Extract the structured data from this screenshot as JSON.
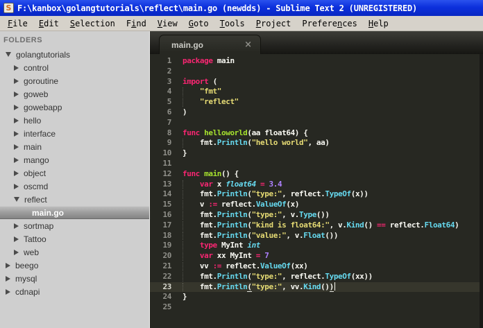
{
  "window": {
    "title": "F:\\kanbox\\golangtutorials\\reflect\\main.go (newdds) - Sublime Text 2 (UNREGISTERED)",
    "app_icon_letter": "S"
  },
  "menu": {
    "items": [
      {
        "label": "File",
        "u": 0
      },
      {
        "label": "Edit",
        "u": 0
      },
      {
        "label": "Selection",
        "u": 0
      },
      {
        "label": "Find",
        "u": 1
      },
      {
        "label": "View",
        "u": 0
      },
      {
        "label": "Goto",
        "u": 0
      },
      {
        "label": "Tools",
        "u": 0
      },
      {
        "label": "Project",
        "u": 0
      },
      {
        "label": "Preferences",
        "u": 7
      },
      {
        "label": "Help",
        "u": 0
      }
    ]
  },
  "sidebar": {
    "header": "FOLDERS",
    "items": [
      {
        "label": "golangtutorials",
        "level": 0,
        "kind": "open"
      },
      {
        "label": "control",
        "level": 1,
        "kind": "closed"
      },
      {
        "label": "goroutine",
        "level": 1,
        "kind": "closed"
      },
      {
        "label": "goweb",
        "level": 1,
        "kind": "closed"
      },
      {
        "label": "gowebapp",
        "level": 1,
        "kind": "closed"
      },
      {
        "label": "hello",
        "level": 1,
        "kind": "closed"
      },
      {
        "label": "interface",
        "level": 1,
        "kind": "closed"
      },
      {
        "label": "main",
        "level": 1,
        "kind": "closed"
      },
      {
        "label": "mango",
        "level": 1,
        "kind": "closed"
      },
      {
        "label": "object",
        "level": 1,
        "kind": "closed"
      },
      {
        "label": "oscmd",
        "level": 1,
        "kind": "closed"
      },
      {
        "label": "reflect",
        "level": 1,
        "kind": "open"
      },
      {
        "label": "main.go",
        "level": 2,
        "kind": "file",
        "selected": true
      },
      {
        "label": "sortmap",
        "level": 1,
        "kind": "closed"
      },
      {
        "label": "Tattoo",
        "level": 1,
        "kind": "closed"
      },
      {
        "label": "web",
        "level": 1,
        "kind": "closed"
      },
      {
        "label": "beego",
        "level": 0,
        "kind": "closed"
      },
      {
        "label": "mysql",
        "level": 0,
        "kind": "closed"
      },
      {
        "label": "cdnapi",
        "level": 0,
        "kind": "closed"
      }
    ]
  },
  "tab": {
    "label": "main.go",
    "close_glyph": "×"
  },
  "theme": {
    "titlebar_blue": "#0c30dc",
    "menubar_bg": "#d6d2ca",
    "sidebar_bg": "#cfcfcf",
    "editor_bg": "#272822",
    "current_line_bg": "#36362c",
    "line_number": "#90908a",
    "keyword_pink": "#f92672",
    "string_yellow": "#e6db74",
    "call_cyan": "#66d9ef",
    "number_purple": "#ae81ff",
    "type_italic_cyan": "#66d9ef",
    "func_def_green": "#a6e22e",
    "plain_text": "#f8f8f2"
  },
  "editor": {
    "lines": [
      {
        "n": 1,
        "seg": [
          [
            "package",
            "kw"
          ],
          [
            " main",
            "pl"
          ]
        ]
      },
      {
        "n": 2,
        "seg": []
      },
      {
        "n": 3,
        "seg": [
          [
            "import",
            "kw"
          ],
          [
            " (",
            "pl"
          ]
        ]
      },
      {
        "n": 4,
        "g": 1,
        "seg": [
          [
            "    ",
            "pl"
          ],
          [
            "\"fmt\"",
            "str"
          ]
        ]
      },
      {
        "n": 5,
        "g": 1,
        "seg": [
          [
            "    ",
            "pl"
          ],
          [
            "\"reflect\"",
            "str"
          ]
        ]
      },
      {
        "n": 6,
        "seg": [
          [
            ")",
            "pl"
          ]
        ]
      },
      {
        "n": 7,
        "seg": []
      },
      {
        "n": 8,
        "seg": [
          [
            "func",
            "kw"
          ],
          [
            " ",
            "pl"
          ],
          [
            "helloworld",
            "fn"
          ],
          [
            "(aa float64) {",
            "pl"
          ]
        ]
      },
      {
        "n": 9,
        "g": 1,
        "seg": [
          [
            "    fmt.",
            "pl"
          ],
          [
            "Println",
            "call"
          ],
          [
            "(",
            "pl"
          ],
          [
            "\"hello world\"",
            "str"
          ],
          [
            ", aa)",
            "pl"
          ]
        ]
      },
      {
        "n": 10,
        "seg": [
          [
            "}",
            "pl"
          ]
        ]
      },
      {
        "n": 11,
        "seg": []
      },
      {
        "n": 12,
        "seg": [
          [
            "func",
            "kw"
          ],
          [
            " ",
            "pl"
          ],
          [
            "main",
            "fn"
          ],
          [
            "() {",
            "pl"
          ]
        ]
      },
      {
        "n": 13,
        "g": 1,
        "seg": [
          [
            "    ",
            "pl"
          ],
          [
            "var",
            "kw"
          ],
          [
            " x ",
            "pl"
          ],
          [
            "float64",
            "typ"
          ],
          [
            " ",
            "pl"
          ],
          [
            "=",
            "kw"
          ],
          [
            " ",
            "pl"
          ],
          [
            "3.4",
            "num"
          ]
        ]
      },
      {
        "n": 14,
        "g": 1,
        "seg": [
          [
            "    fmt.",
            "pl"
          ],
          [
            "Println",
            "call"
          ],
          [
            "(",
            "pl"
          ],
          [
            "\"type:\"",
            "str"
          ],
          [
            ", reflect.",
            "pl"
          ],
          [
            "TypeOf",
            "call"
          ],
          [
            "(x))",
            "pl"
          ]
        ]
      },
      {
        "n": 15,
        "g": 1,
        "seg": [
          [
            "    v ",
            "pl"
          ],
          [
            ":=",
            "kw"
          ],
          [
            " reflect.",
            "pl"
          ],
          [
            "ValueOf",
            "call"
          ],
          [
            "(x)",
            "pl"
          ]
        ]
      },
      {
        "n": 16,
        "g": 1,
        "seg": [
          [
            "    fmt.",
            "pl"
          ],
          [
            "Println",
            "call"
          ],
          [
            "(",
            "pl"
          ],
          [
            "\"type:\"",
            "str"
          ],
          [
            ", v.",
            "pl"
          ],
          [
            "Type",
            "call"
          ],
          [
            "())",
            "pl"
          ]
        ]
      },
      {
        "n": 17,
        "g": 1,
        "seg": [
          [
            "    fmt.",
            "pl"
          ],
          [
            "Println",
            "call"
          ],
          [
            "(",
            "pl"
          ],
          [
            "\"kind is float64:\"",
            "str"
          ],
          [
            ", v.",
            "pl"
          ],
          [
            "Kind",
            "call"
          ],
          [
            "() ",
            "pl"
          ],
          [
            "==",
            "kw"
          ],
          [
            " reflect.",
            "pl"
          ],
          [
            "Float64",
            "call"
          ],
          [
            ")",
            "pl"
          ]
        ]
      },
      {
        "n": 18,
        "g": 1,
        "seg": [
          [
            "    fmt.",
            "pl"
          ],
          [
            "Println",
            "call"
          ],
          [
            "(",
            "pl"
          ],
          [
            "\"value:\"",
            "str"
          ],
          [
            ", v.",
            "pl"
          ],
          [
            "Float",
            "call"
          ],
          [
            "())",
            "pl"
          ]
        ]
      },
      {
        "n": 19,
        "g": 1,
        "seg": [
          [
            "    ",
            "pl"
          ],
          [
            "type",
            "kw"
          ],
          [
            " MyInt ",
            "pl"
          ],
          [
            "int",
            "typ"
          ]
        ]
      },
      {
        "n": 20,
        "g": 1,
        "seg": [
          [
            "    ",
            "pl"
          ],
          [
            "var",
            "kw"
          ],
          [
            " xx MyInt ",
            "pl"
          ],
          [
            "=",
            "kw"
          ],
          [
            " ",
            "pl"
          ],
          [
            "7",
            "num"
          ]
        ]
      },
      {
        "n": 21,
        "g": 1,
        "seg": [
          [
            "    vv ",
            "pl"
          ],
          [
            ":=",
            "kw"
          ],
          [
            " reflect.",
            "pl"
          ],
          [
            "ValueOf",
            "call"
          ],
          [
            "(xx)",
            "pl"
          ]
        ]
      },
      {
        "n": 22,
        "g": 1,
        "seg": [
          [
            "    fmt.",
            "pl"
          ],
          [
            "Println",
            "call"
          ],
          [
            "(",
            "pl"
          ],
          [
            "\"type:\"",
            "str"
          ],
          [
            ", reflect.",
            "pl"
          ],
          [
            "TypeOf",
            "call"
          ],
          [
            "(xx))",
            "pl"
          ]
        ]
      },
      {
        "n": 23,
        "g": 1,
        "cur": true,
        "caret": true,
        "seg": [
          [
            "    fmt.",
            "pl"
          ],
          [
            "Println",
            "call"
          ],
          [
            "(",
            "brk"
          ],
          [
            "\"type:\"",
            "str"
          ],
          [
            ", vv.",
            "pl"
          ],
          [
            "Kind",
            "call"
          ],
          [
            "()",
            "pl"
          ],
          [
            ")",
            "brk"
          ]
        ]
      },
      {
        "n": 24,
        "seg": [
          [
            "}",
            "pl"
          ]
        ]
      },
      {
        "n": 25,
        "seg": []
      }
    ]
  }
}
